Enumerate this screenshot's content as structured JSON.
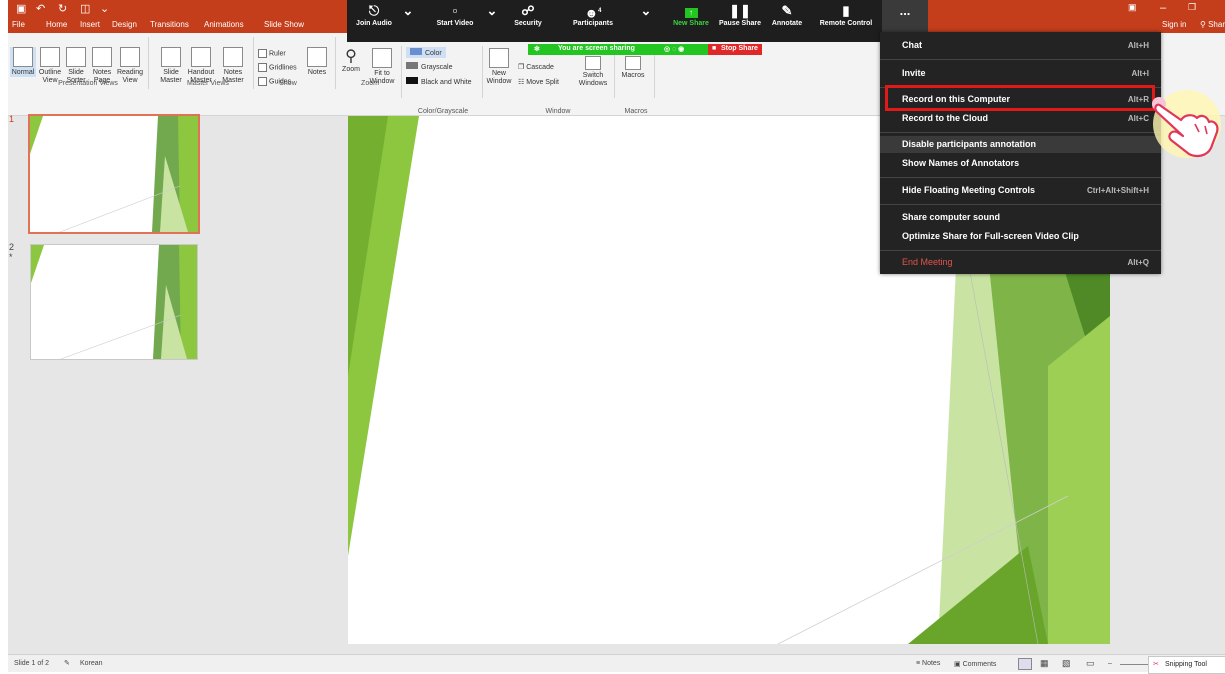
{
  "quick_access": {
    "save_icon": "save-icon",
    "undo_icon": "undo-icon",
    "redo_icon": "redo-icon",
    "present_icon": "present-icon"
  },
  "ribbon_tabs": [
    "File",
    "Home",
    "Insert",
    "Design",
    "Transitions",
    "Animations",
    "Slide Show"
  ],
  "account": {
    "sign_in": "Sign in",
    "share": "Shar"
  },
  "ribbon": {
    "views": [
      "Normal",
      "Outline View",
      "Slide Sorter",
      "Notes Page",
      "Reading View"
    ],
    "presentation_views_label": "Presentation Views",
    "masters": [
      "Slide Master",
      "Handout Master",
      "Notes Master"
    ],
    "master_views_label": "Master Views",
    "show_checks": [
      "Ruler",
      "Gridlines",
      "Guides"
    ],
    "notes_label": "Notes",
    "show_label": "Show",
    "zoom": [
      "Zoom",
      "Fit to Window"
    ],
    "zoom_label": "Zoom",
    "color_options": [
      "Color",
      "Grayscale",
      "Black and White"
    ],
    "color_label": "Color/Grayscale",
    "window_items": [
      "New Window",
      "Cascade",
      "Move Split",
      "Switch Windows"
    ],
    "window_label": "Window",
    "macros": "Macros",
    "macros_label": "Macros"
  },
  "zoom_toolbar": {
    "buttons": [
      "Join Audio",
      "Start Video",
      "Security",
      "Participants",
      "New Share",
      "Pause Share",
      "Annotate",
      "Remote Control"
    ],
    "participants_count": "4",
    "more_label": "..."
  },
  "share_banner": {
    "text": "You are screen sharing",
    "stop": "Stop Share"
  },
  "more_menu": {
    "items": [
      {
        "label": "Chat",
        "shortcut": "Alt+H"
      },
      {
        "label": "Invite",
        "shortcut": "Alt+I"
      },
      {
        "label": "Record on this Computer",
        "shortcut": "Alt+R"
      },
      {
        "label": "Record to the Cloud",
        "shortcut": "Alt+C"
      },
      {
        "label": "Disable participants annotation",
        "shortcut": ""
      },
      {
        "label": "Show Names of Annotators",
        "shortcut": ""
      },
      {
        "label": "Hide Floating Meeting Controls",
        "shortcut": "Ctrl+Alt+Shift+H"
      },
      {
        "label": "Share computer sound",
        "shortcut": ""
      },
      {
        "label": "Optimize Share for Full-screen Video Clip",
        "shortcut": ""
      },
      {
        "label": "End Meeting",
        "shortcut": "Alt+Q"
      }
    ],
    "end_color": "#e0544b"
  },
  "slides": {
    "numbers": [
      "1",
      "2"
    ],
    "star": "*"
  },
  "status": {
    "slide_info": "Slide 1 of 2",
    "language": "Korean",
    "notes": "Notes",
    "comments": "Comments"
  },
  "snipping": "Snipping Tool",
  "colors": {
    "ppt_accent": "#c43e1c",
    "zoom_bg": "#1e1e1e",
    "share_green": "#23c521",
    "stop_red": "#e02828",
    "slide_green": "#8dc63f"
  }
}
